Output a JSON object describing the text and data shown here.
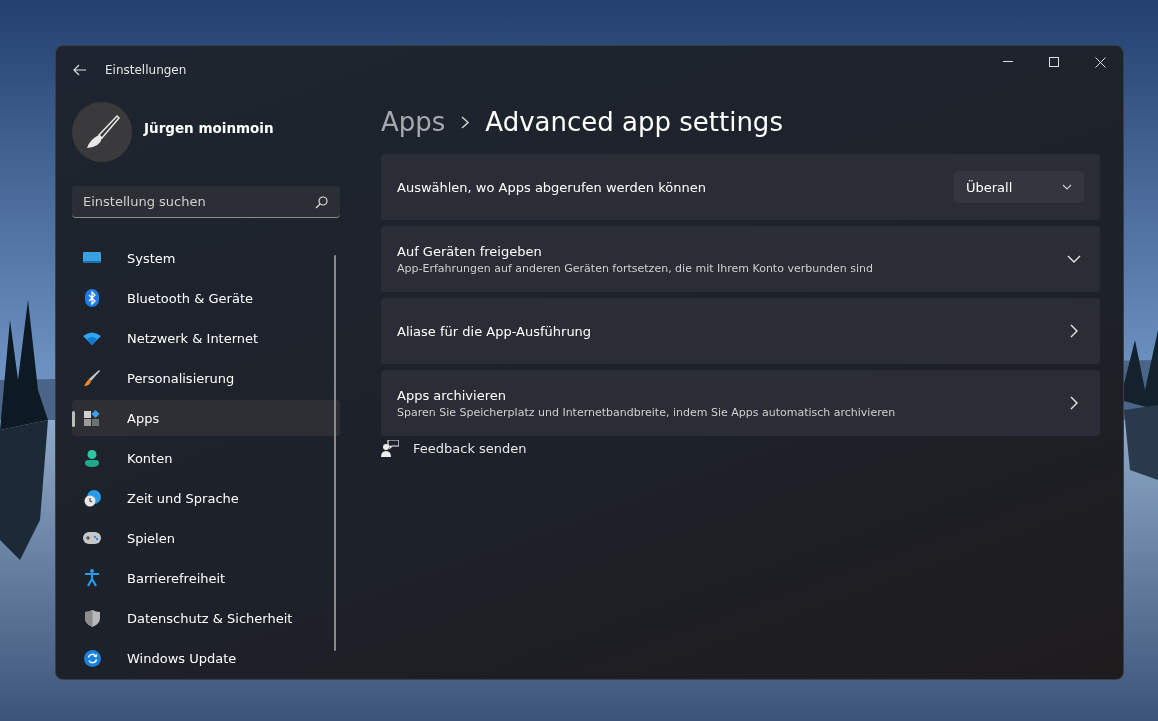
{
  "window": {
    "title": "Einstellungen"
  },
  "user": {
    "name": "Jürgen moinmoin"
  },
  "search": {
    "placeholder": "Einstellung suchen"
  },
  "sidebar": {
    "items": [
      {
        "label": "System",
        "selected": false
      },
      {
        "label": "Bluetooth & Geräte",
        "selected": false
      },
      {
        "label": "Netzwerk & Internet",
        "selected": false
      },
      {
        "label": "Personalisierung",
        "selected": false
      },
      {
        "label": "Apps",
        "selected": true
      },
      {
        "label": "Konten",
        "selected": false
      },
      {
        "label": "Zeit und Sprache",
        "selected": false
      },
      {
        "label": "Spielen",
        "selected": false
      },
      {
        "label": "Barrierefreiheit",
        "selected": false
      },
      {
        "label": "Datenschutz & Sicherheit",
        "selected": false
      },
      {
        "label": "Windows Update",
        "selected": false
      }
    ]
  },
  "breadcrumb": {
    "parent": "Apps",
    "current": "Advanced app settings"
  },
  "settings": [
    {
      "kind": "dropdown",
      "title": "Auswählen, wo Apps abgerufen werden können",
      "value": "Überall"
    },
    {
      "kind": "expander",
      "title": "Auf Geräten freigeben",
      "description": "App-Erfahrungen auf anderen Geräten fortsetzen, die mit Ihrem Konto verbunden sind",
      "expanded": false
    },
    {
      "kind": "link",
      "title": "Aliase für die App-Ausführung"
    },
    {
      "kind": "link",
      "title": "Apps archivieren",
      "description": "Sparen Sie Speicherplatz und Internetbandbreite, indem Sie Apps automatisch archivieren"
    }
  ],
  "feedback": {
    "label": "Feedback senden"
  }
}
